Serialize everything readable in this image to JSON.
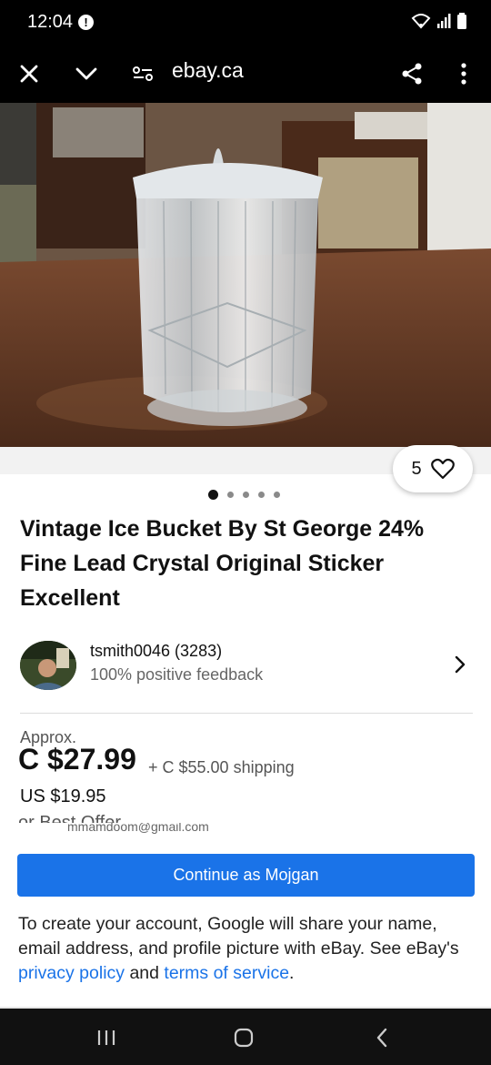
{
  "status_bar": {
    "time": "12:04",
    "alert_glyph": "!",
    "icons": [
      "wifi-icon",
      "signal-icon",
      "battery-icon"
    ]
  },
  "browser": {
    "url": "ebay.ca",
    "icons": [
      "close-icon",
      "chevron-down-icon",
      "site-settings-icon",
      "share-icon",
      "more-vert-icon"
    ]
  },
  "listing": {
    "watch_count": "5",
    "carousel": {
      "total": 5,
      "active_index": 0
    },
    "title": "Vintage Ice Bucket By St George 24% Fine Lead Crystal Original Sticker Excellent",
    "seller": {
      "name": "tsmith0046 (3283)",
      "feedback": "100% positive feedback"
    },
    "approx_label": "Approx.",
    "price": "C $27.99",
    "shipping": "+ C $55.00 shipping",
    "usd_price": "US $19.95",
    "best_offer": "or Best Offer"
  },
  "google_sheet": {
    "email_partial": "mmamdoom@gmail.com",
    "continue_label": "Continue as Mojgan",
    "consent_prefix": "To create your account, Google will share your name, email address, and profile picture with eBay. See eBay's ",
    "privacy_link": "privacy policy",
    "and_text": " and ",
    "terms_link": "terms of service",
    "suffix": "."
  },
  "nav_bar": {
    "icons": [
      "recent-apps-icon",
      "home-icon",
      "back-icon"
    ]
  },
  "colors": {
    "accent": "#1a73e8",
    "background": "#ffffff",
    "system_bar": "#000000"
  }
}
